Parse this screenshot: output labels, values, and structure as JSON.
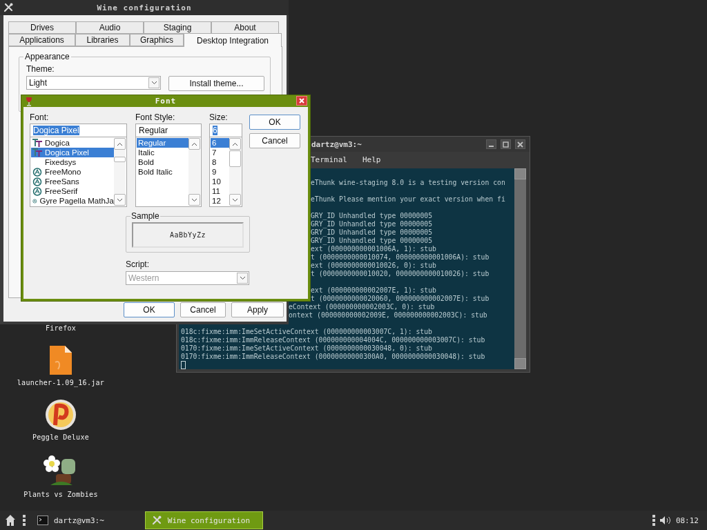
{
  "desktop_icons": [
    {
      "label": "Firefox",
      "kind": "covered"
    },
    {
      "label": "launcher-1.09_16.jar",
      "kind": "archive"
    },
    {
      "label": "Peggle Deluxe",
      "kind": "peggle"
    },
    {
      "label": "Plants vs Zombies",
      "kind": "plants"
    }
  ],
  "terminal": {
    "title": "dartz@vm3:~",
    "menus": [
      "Terminal",
      "Help"
    ],
    "blocks": [
      {
        "lines": [
          "eThunk wine-staging 8.0 is a testing version con"
        ]
      },
      {
        "lines": [
          "eThunk Please mention your exact version when fi"
        ]
      },
      {
        "lines": [
          "GRY_ID Unhandled type 00000005",
          "GRY_ID Unhandled type 00000005",
          "GRY_ID Unhandled type 00000005",
          "GRY_ID Unhandled type 00000005",
          "ext (000000000001006A, 1): stub",
          "t (0000000000010074, 000000000001006A): stub",
          "ext (0000000000010026, 0): stub",
          "t (0000000000010020, 0000000000010026): stub"
        ]
      },
      {
        "lines": [
          "ext (000000000002007E, 1): stub",
          "t (0000000000020060, 000000000002007E): stub",
          "eContext (000000000002003C, 0): stub",
          "ontext (000000000002009E, 000000000002003C): stub"
        ]
      },
      {
        "lines": [
          "018c:fixme:imm:ImeSetActiveContext (000000000003007C, 1): stub",
          "018c:fixme:imm:ImmReleaseContext (000000000004004C, 000000000003007C): stub",
          "0170:fixme:imm:ImeSetActiveContext (0000000000030048, 0): stub",
          "0170:fixme:imm:ImmReleaseContext (00000000000300A0, 0000000000030048): stub"
        ]
      }
    ]
  },
  "wine_window": {
    "title": "Wine configuration",
    "tab_rows": [
      {
        "tabs": [
          {
            "label": "Drives",
            "selected": false
          },
          {
            "label": "Audio",
            "selected": false
          },
          {
            "label": "Staging",
            "selected": false
          },
          {
            "label": "About",
            "selected": false
          }
        ]
      },
      {
        "tabs": [
          {
            "label": "Applications",
            "selected": false
          },
          {
            "label": "Libraries",
            "selected": false
          },
          {
            "label": "Graphics",
            "selected": false
          },
          {
            "label": "Desktop Integration",
            "selected": true
          }
        ]
      }
    ],
    "group_title": "Appearance",
    "theme_label": "Theme:",
    "theme_value": "Light",
    "install_button": "Install theme...",
    "buttons": [
      {
        "label": "OK",
        "default": true
      },
      {
        "label": "Cancel",
        "default": false
      },
      {
        "label": "Apply",
        "default": false
      }
    ]
  },
  "font_dialog": {
    "title": "Font",
    "font_label": "Font:",
    "font_value": "Dogica Pixel",
    "font_value_highlighted": true,
    "fonts": [
      {
        "name": "Dogica",
        "kind": "truetype",
        "selected": false
      },
      {
        "name": "Dogica Pixel",
        "kind": "truetype",
        "selected": true
      },
      {
        "name": "Fixedsys",
        "kind": "plain",
        "selected": false
      },
      {
        "name": "FreeMono",
        "kind": "opentype",
        "selected": false
      },
      {
        "name": "FreeSans",
        "kind": "opentype",
        "selected": false
      },
      {
        "name": "FreeSerif",
        "kind": "opentype",
        "selected": false
      },
      {
        "name": "Gyre Pagella MathJa",
        "kind": "opentype",
        "selected": false
      }
    ],
    "style_label": "Font Style:",
    "style_value": "Regular",
    "style_value_highlighted": false,
    "styles": [
      {
        "name": "Regular",
        "selected": true
      },
      {
        "name": "Italic",
        "selected": false
      },
      {
        "name": "Bold",
        "selected": false
      },
      {
        "name": "Bold Italic",
        "selected": false
      }
    ],
    "size_label": "Size:",
    "size_value": "6",
    "size_value_highlighted": true,
    "sizes": [
      {
        "name": "6",
        "selected": true
      },
      {
        "name": "7",
        "selected": false
      },
      {
        "name": "8",
        "selected": false
      },
      {
        "name": "9",
        "selected": false
      },
      {
        "name": "10",
        "selected": false
      },
      {
        "name": "11",
        "selected": false
      },
      {
        "name": "12",
        "selected": false
      }
    ],
    "buttons": [
      {
        "label": "OK",
        "default": true
      },
      {
        "label": "Cancel",
        "default": false
      }
    ],
    "sample_label": "Sample",
    "sample_text": "AaBbYyZz",
    "script_label": "Script:",
    "script_value": "Western",
    "script_disabled": true
  },
  "taskbar": {
    "tasks": [
      {
        "label": "dartz@vm3:~",
        "kind": "terminal",
        "active": false
      },
      {
        "label": "Wine configuration",
        "kind": "tools",
        "active": true
      }
    ],
    "clock": "08:12"
  }
}
